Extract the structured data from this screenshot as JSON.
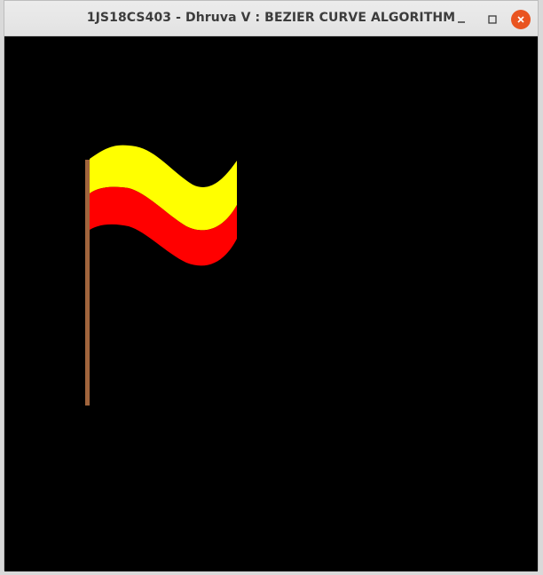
{
  "window": {
    "title": "1JS18CS403 - Dhruva V : BEZIER CURVE ALGORITHM",
    "controls": {
      "minimize_icon": "minimize-icon",
      "maximize_icon": "maximize-icon",
      "close_icon": "close-icon"
    }
  },
  "canvas": {
    "background": "#000000",
    "flag": {
      "top_color": "#ffff00",
      "bottom_color": "#ff0000",
      "pole_color": "#a0643c"
    }
  }
}
